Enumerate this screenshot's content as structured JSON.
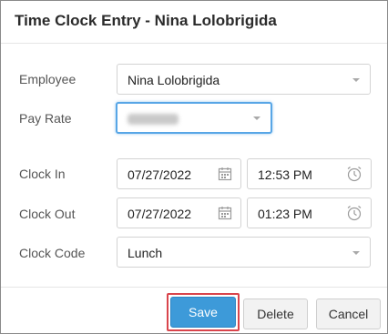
{
  "dialog": {
    "title": "Time Clock Entry - Nina Lolobrigida"
  },
  "form": {
    "employee_label": "Employee",
    "employee_value": "Nina Lolobrigida",
    "pay_rate_label": "Pay Rate",
    "clock_in_label": "Clock In",
    "clock_in_date": "07/27/2022",
    "clock_in_time": "12:53 PM",
    "clock_out_label": "Clock Out",
    "clock_out_date": "07/27/2022",
    "clock_out_time": "01:23 PM",
    "clock_code_label": "Clock Code",
    "clock_code_value": "Lunch"
  },
  "buttons": {
    "save": "Save",
    "delete": "Delete",
    "cancel": "Cancel"
  },
  "colors": {
    "primary": "#3d9ad9",
    "focus": "#58a6e6",
    "highlight": "#d9454c"
  }
}
